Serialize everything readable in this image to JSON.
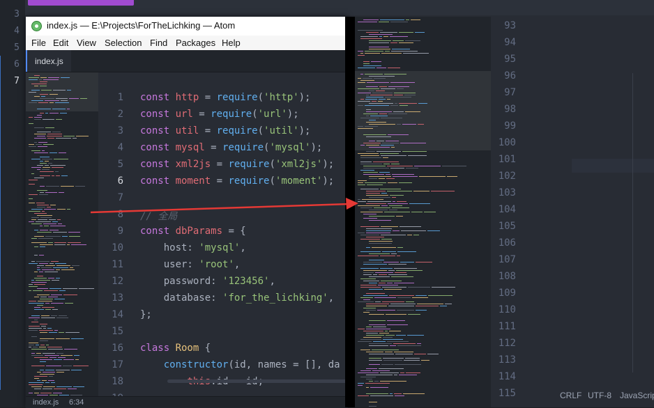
{
  "background_editor": {
    "line_numbers": [
      "3",
      "4",
      "5",
      "6",
      "7"
    ],
    "active_line": "7",
    "status": {
      "line_ending": "CRLF",
      "encoding": "UTF-8",
      "grammar": "JavaScript"
    }
  },
  "window": {
    "title": "index.js — E:\\Projects\\ForTheLichking — Atom",
    "menu": [
      "File",
      "Edit",
      "View",
      "Selection",
      "Find",
      "Packages",
      "Help"
    ],
    "tab": "index.js",
    "status": {
      "file": "index.js",
      "cursor": "6:34"
    }
  },
  "editor": {
    "active_line": "6",
    "lines": [
      {
        "n": "1",
        "segs": [
          [
            "kw",
            "const "
          ],
          [
            "id",
            "http"
          ],
          [
            "p",
            " = "
          ],
          [
            "fn",
            "require"
          ],
          [
            "p",
            "("
          ],
          [
            "st",
            "'http'"
          ],
          [
            "p",
            ");"
          ]
        ]
      },
      {
        "n": "2",
        "segs": [
          [
            "kw",
            "const "
          ],
          [
            "id",
            "url"
          ],
          [
            "p",
            " = "
          ],
          [
            "fn",
            "require"
          ],
          [
            "p",
            "("
          ],
          [
            "st",
            "'url'"
          ],
          [
            "p",
            ");"
          ]
        ]
      },
      {
        "n": "3",
        "segs": [
          [
            "kw",
            "const "
          ],
          [
            "id",
            "util"
          ],
          [
            "p",
            " = "
          ],
          [
            "fn",
            "require"
          ],
          [
            "p",
            "("
          ],
          [
            "st",
            "'util'"
          ],
          [
            "p",
            ");"
          ]
        ]
      },
      {
        "n": "4",
        "segs": [
          [
            "kw",
            "const "
          ],
          [
            "id",
            "mysql"
          ],
          [
            "p",
            " = "
          ],
          [
            "fn",
            "require"
          ],
          [
            "p",
            "("
          ],
          [
            "st",
            "'mysql'"
          ],
          [
            "p",
            ");"
          ]
        ]
      },
      {
        "n": "5",
        "segs": [
          [
            "kw",
            "const "
          ],
          [
            "id",
            "xml2js"
          ],
          [
            "p",
            " = "
          ],
          [
            "fn",
            "require"
          ],
          [
            "p",
            "("
          ],
          [
            "st",
            "'xml2js'"
          ],
          [
            "p",
            ");"
          ]
        ]
      },
      {
        "n": "6",
        "segs": [
          [
            "kw",
            "const "
          ],
          [
            "id",
            "moment"
          ],
          [
            "p",
            " = "
          ],
          [
            "fn",
            "require"
          ],
          [
            "p",
            "("
          ],
          [
            "st",
            "'moment'"
          ],
          [
            "p",
            ");"
          ]
        ]
      },
      {
        "n": "7",
        "segs": []
      },
      {
        "n": "8",
        "segs": [
          [
            "cm",
            "// 全局"
          ]
        ]
      },
      {
        "n": "9",
        "segs": [
          [
            "kw",
            "const "
          ],
          [
            "id",
            "dbParams"
          ],
          [
            "p",
            " = {"
          ]
        ]
      },
      {
        "n": "10",
        "segs": [
          [
            "p",
            "    host: "
          ],
          [
            "st",
            "'mysql'"
          ],
          [
            "p",
            ","
          ]
        ]
      },
      {
        "n": "11",
        "segs": [
          [
            "p",
            "    user: "
          ],
          [
            "st",
            "'root'"
          ],
          [
            "p",
            ","
          ]
        ]
      },
      {
        "n": "12",
        "segs": [
          [
            "p",
            "    password: "
          ],
          [
            "st",
            "'123456'"
          ],
          [
            "p",
            ","
          ]
        ]
      },
      {
        "n": "13",
        "segs": [
          [
            "p",
            "    database: "
          ],
          [
            "st",
            "'for_the_lichking'"
          ],
          [
            "p",
            ","
          ]
        ]
      },
      {
        "n": "14",
        "segs": [
          [
            "p",
            "};"
          ]
        ]
      },
      {
        "n": "15",
        "segs": []
      },
      {
        "n": "16",
        "segs": [
          [
            "kw",
            "class "
          ],
          [
            "cls",
            "Room"
          ],
          [
            "p",
            " {"
          ]
        ]
      },
      {
        "n": "17",
        "segs": [
          [
            "p",
            "    "
          ],
          [
            "fn",
            "constructor"
          ],
          [
            "p",
            "(id, names = [], da"
          ]
        ]
      },
      {
        "n": "18",
        "segs": [
          [
            "p",
            "        "
          ],
          [
            "th",
            "this"
          ],
          [
            "p",
            ".id = id;"
          ]
        ]
      },
      {
        "n": "19",
        "segs": []
      }
    ]
  },
  "second_window": {
    "line_numbers": [
      "93",
      "94",
      "95",
      "96",
      "97",
      "98",
      "99",
      "100",
      "101",
      "102",
      "103",
      "104",
      "105",
      "106",
      "107",
      "108",
      "109",
      "110",
      "111",
      "112",
      "113",
      "114",
      "115"
    ]
  },
  "colors": {
    "editor_bg": "#282c34",
    "gutter_bg": "#21252b",
    "keyword": "#c678dd",
    "function": "#61afef",
    "string": "#98c379",
    "comment": "#5c6370",
    "arrow": "#e53935"
  },
  "icons": {
    "atom_logo": "atom-logo-icon",
    "arrow": "arrow-annotation-icon"
  }
}
